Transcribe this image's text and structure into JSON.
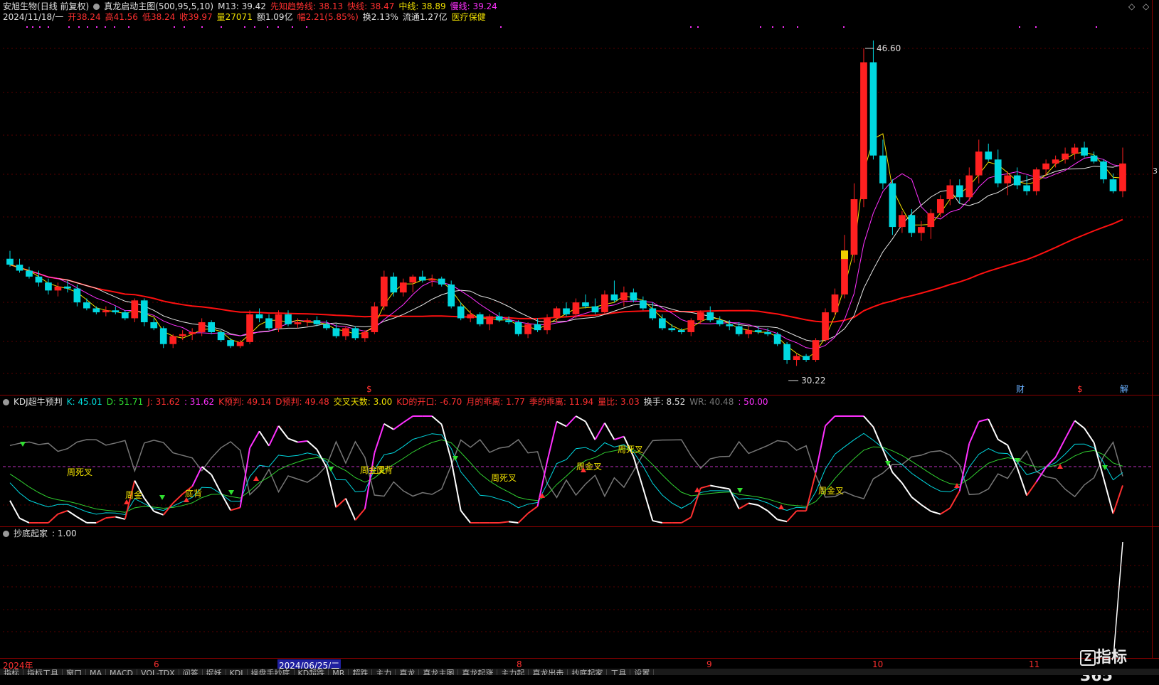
{
  "main": {
    "stock_name": "安旭生物",
    "mode": "(日线 前复权)",
    "indicator": "真龙启动主图(500,95,5,10)",
    "m13": "M13: 39.42",
    "trend_line": "先知趋势线: 38.13",
    "fast_line": "快线: 38.47",
    "mid_line": "中线: 38.89",
    "slow_line": "慢线: 39.24",
    "date": "2024/11/18/一",
    "open": "开38.24",
    "high": "高41.56",
    "low": "低38.24",
    "close": "收39.97",
    "volume": "量27071",
    "amount": "额1.09亿",
    "change": "幅2.21(5.85%)",
    "turnover": "换2.13%",
    "float": "流通1.27亿",
    "sector": "医疗保健",
    "max_label": "46.60",
    "min_label": "30.22",
    "right_edge_label": "3",
    "markers": [
      "$",
      "财",
      "$",
      "解"
    ]
  },
  "kdj": {
    "title": "KDJ超牛预判",
    "k": "K: 45.01",
    "d": "D: 51.71",
    "j": "J: 31.62",
    "j2": ": 31.62",
    "k_pred": "K预判: 49.14",
    "d_pred": "D预判: 49.48",
    "cross_days": "交叉天数: 3.00",
    "kd_gap": "KD的开口: -6.70",
    "month_dev": "月的乖离: 1.77",
    "season_dev": "季的乖离: 11.94",
    "vol_ratio": "量比: 3.03",
    "turnover": "换手: 8.52",
    "wr": "WR: 40.48",
    "wr2": ": 50.00",
    "annotations": [
      "周死叉",
      "周金",
      "底背",
      "周金叉",
      "顶背",
      "周死叉",
      "周金叉",
      "周死叉",
      "周金叉"
    ]
  },
  "bottom": {
    "title": "抄底起家",
    "value": ": 1.00"
  },
  "axis": {
    "labels": [
      "2024年",
      "6",
      "2024/06/25/二",
      "8",
      "9",
      "10",
      "11"
    ]
  },
  "watermark": "指标365",
  "tabs": [
    "指标",
    "指标工具",
    "窗口",
    "MA",
    "MACD",
    "VOL-TDX",
    "问答",
    "捉妖",
    "KDJ",
    "操盘手抄底",
    "KD超跌",
    "MR",
    "超跌",
    "主力",
    "真龙",
    "真龙主图",
    "真龙起涨",
    "主力起",
    "真龙出击",
    "抄底起家",
    "工具",
    "设置"
  ],
  "colors": {
    "up": "#ff2020",
    "down": "#00d8e0",
    "ma_white": "#e8e8e8",
    "ma_yellow": "#f0e000",
    "ma_magenta": "#ff30ff",
    "ma_red": "#ff1010",
    "sep": "#8b0000"
  },
  "chart_data": {
    "type": "candlestick",
    "y_max_label": 46.6,
    "y_min_label": 30.22,
    "candles": [
      [
        36.0,
        36.4,
        35.6,
        35.7
      ],
      [
        35.7,
        36.0,
        35.3,
        35.4
      ],
      [
        35.4,
        35.6,
        35.0,
        35.1
      ],
      [
        35.1,
        35.4,
        34.6,
        34.8
      ],
      [
        34.8,
        35.0,
        34.2,
        34.4
      ],
      [
        34.4,
        34.8,
        34.1,
        34.6
      ],
      [
        34.6,
        34.9,
        34.3,
        34.5
      ],
      [
        34.5,
        34.7,
        33.6,
        33.8
      ],
      [
        33.8,
        34.0,
        33.4,
        33.5
      ],
      [
        33.5,
        33.6,
        33.2,
        33.3
      ],
      [
        33.3,
        33.6,
        33.1,
        33.4
      ],
      [
        33.4,
        33.6,
        33.2,
        33.3
      ],
      [
        33.3,
        33.4,
        32.9,
        33.0
      ],
      [
        33.0,
        34.0,
        32.8,
        33.9
      ],
      [
        33.9,
        34.0,
        32.6,
        32.8
      ],
      [
        32.8,
        33.0,
        32.4,
        32.5
      ],
      [
        32.5,
        32.6,
        31.5,
        31.7
      ],
      [
        31.7,
        32.2,
        31.5,
        32.1
      ],
      [
        32.1,
        32.4,
        31.9,
        32.2
      ],
      [
        32.2,
        32.5,
        31.9,
        32.3
      ],
      [
        32.3,
        33.0,
        32.1,
        32.8
      ],
      [
        32.8,
        32.9,
        32.2,
        32.3
      ],
      [
        32.3,
        32.4,
        31.8,
        31.9
      ],
      [
        31.9,
        32.0,
        31.5,
        31.6
      ],
      [
        31.6,
        31.9,
        31.5,
        31.8
      ],
      [
        31.8,
        33.4,
        31.7,
        33.2
      ],
      [
        33.2,
        33.5,
        32.8,
        33.0
      ],
      [
        33.0,
        33.2,
        32.4,
        32.5
      ],
      [
        32.5,
        33.4,
        32.3,
        33.2
      ],
      [
        33.2,
        33.4,
        32.6,
        32.7
      ],
      [
        32.7,
        33.0,
        32.5,
        32.8
      ],
      [
        32.8,
        33.0,
        32.6,
        32.9
      ],
      [
        32.9,
        33.1,
        32.6,
        32.7
      ],
      [
        32.7,
        32.9,
        32.4,
        32.5
      ],
      [
        32.5,
        32.7,
        32.0,
        32.1
      ],
      [
        32.1,
        32.6,
        31.9,
        32.5
      ],
      [
        32.5,
        32.6,
        31.9,
        32.0
      ],
      [
        32.0,
        32.4,
        31.8,
        32.3
      ],
      [
        32.3,
        33.8,
        32.2,
        33.6
      ],
      [
        33.6,
        35.4,
        33.4,
        35.1
      ],
      [
        35.1,
        35.3,
        34.1,
        34.3
      ],
      [
        34.3,
        35.0,
        34.1,
        34.8
      ],
      [
        34.8,
        35.2,
        34.3,
        35.1
      ],
      [
        35.1,
        35.4,
        34.8,
        34.9
      ],
      [
        34.9,
        35.2,
        34.6,
        35.0
      ],
      [
        35.0,
        35.1,
        34.6,
        34.7
      ],
      [
        34.7,
        34.9,
        33.5,
        33.6
      ],
      [
        33.6,
        33.8,
        32.9,
        33.0
      ],
      [
        33.0,
        33.4,
        32.8,
        33.2
      ],
      [
        33.2,
        33.3,
        32.6,
        32.7
      ],
      [
        32.7,
        33.2,
        32.4,
        33.1
      ],
      [
        33.1,
        33.3,
        32.8,
        32.9
      ],
      [
        32.9,
        33.1,
        32.7,
        32.8
      ],
      [
        32.8,
        32.9,
        32.1,
        32.2
      ],
      [
        32.2,
        32.8,
        32.0,
        32.7
      ],
      [
        32.7,
        33.0,
        32.3,
        32.4
      ],
      [
        32.4,
        33.2,
        32.2,
        33.0
      ],
      [
        33.0,
        33.6,
        32.8,
        33.5
      ],
      [
        33.5,
        33.8,
        33.1,
        33.2
      ],
      [
        33.2,
        34.0,
        33.0,
        33.8
      ],
      [
        33.8,
        34.2,
        33.5,
        33.6
      ],
      [
        33.6,
        34.0,
        33.2,
        33.3
      ],
      [
        33.3,
        34.4,
        33.2,
        34.2
      ],
      [
        34.2,
        34.9,
        33.8,
        33.9
      ],
      [
        33.9,
        34.6,
        33.6,
        34.3
      ],
      [
        34.3,
        34.5,
        33.8,
        33.9
      ],
      [
        33.9,
        34.1,
        33.4,
        33.5
      ],
      [
        33.5,
        33.8,
        32.9,
        33.0
      ],
      [
        33.0,
        33.2,
        32.4,
        32.5
      ],
      [
        32.5,
        32.7,
        32.3,
        32.4
      ],
      [
        32.4,
        32.5,
        32.2,
        32.3
      ],
      [
        32.3,
        33.0,
        32.1,
        32.9
      ],
      [
        32.9,
        33.4,
        32.7,
        33.3
      ],
      [
        33.3,
        33.6,
        32.8,
        32.9
      ],
      [
        32.9,
        33.1,
        32.6,
        32.7
      ],
      [
        32.7,
        32.9,
        32.4,
        32.6
      ],
      [
        32.6,
        32.8,
        32.1,
        32.2
      ],
      [
        32.2,
        32.6,
        32.0,
        32.4
      ],
      [
        32.4,
        32.6,
        32.2,
        32.3
      ],
      [
        32.3,
        32.5,
        32.1,
        32.2
      ],
      [
        32.2,
        32.3,
        31.6,
        31.7
      ],
      [
        31.7,
        31.8,
        30.7,
        30.9
      ],
      [
        30.9,
        31.2,
        30.6,
        31.1
      ],
      [
        31.1,
        31.2,
        30.8,
        30.9
      ],
      [
        30.9,
        32.0,
        30.8,
        31.9
      ],
      [
        31.9,
        33.5,
        31.8,
        33.3
      ],
      [
        33.3,
        34.5,
        33.1,
        34.2
      ],
      [
        34.2,
        37.2,
        34.0,
        36.2
      ],
      [
        36.2,
        39.8,
        35.8,
        39.0
      ],
      [
        39.0,
        46.6,
        38.6,
        45.9
      ],
      [
        45.9,
        47.0,
        41.0,
        41.2
      ],
      [
        41.2,
        42.0,
        39.5,
        39.8
      ],
      [
        39.8,
        40.0,
        37.2,
        37.6
      ],
      [
        37.6,
        38.4,
        37.3,
        38.2
      ],
      [
        38.2,
        38.5,
        37.1,
        37.3
      ],
      [
        37.3,
        37.9,
        36.9,
        37.6
      ],
      [
        37.6,
        38.5,
        37.0,
        38.3
      ],
      [
        38.3,
        39.2,
        38.1,
        39.0
      ],
      [
        39.0,
        40.0,
        38.7,
        39.7
      ],
      [
        39.7,
        40.0,
        38.8,
        39.1
      ],
      [
        39.1,
        40.6,
        38.9,
        40.2
      ],
      [
        40.2,
        42.0,
        39.8,
        41.4
      ],
      [
        41.4,
        41.8,
        40.9,
        41.0
      ],
      [
        41.0,
        41.5,
        39.6,
        39.8
      ],
      [
        39.8,
        40.4,
        39.2,
        40.2
      ],
      [
        40.2,
        40.6,
        39.5,
        39.7
      ],
      [
        39.7,
        40.2,
        39.2,
        39.4
      ],
      [
        39.4,
        40.6,
        39.2,
        40.5
      ],
      [
        40.5,
        41.0,
        40.2,
        40.8
      ],
      [
        40.8,
        41.2,
        40.6,
        41.0
      ],
      [
        41.0,
        41.6,
        40.8,
        41.3
      ],
      [
        41.3,
        41.8,
        41.0,
        41.6
      ],
      [
        41.6,
        41.9,
        41.1,
        41.2
      ],
      [
        41.2,
        41.4,
        40.8,
        40.9
      ],
      [
        40.9,
        41.0,
        39.8,
        40.0
      ],
      [
        40.0,
        40.3,
        39.3,
        39.4
      ],
      [
        39.4,
        41.6,
        39.1,
        40.8
      ]
    ]
  }
}
